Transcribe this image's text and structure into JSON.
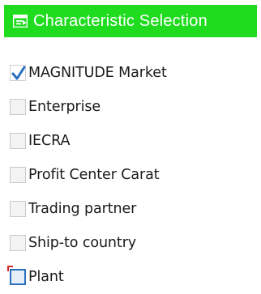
{
  "header": {
    "title": "Characteristic Selection",
    "icon": "selection-list-icon",
    "background": "#1fdc1f",
    "text_color": "#ffffff"
  },
  "characteristics": [
    {
      "label": "MAGNITUDE Market",
      "checked": true
    },
    {
      "label": "Enterprise",
      "checked": false
    },
    {
      "label": "IECRA",
      "checked": false
    },
    {
      "label": "Profit Center Carat",
      "checked": false
    },
    {
      "label": "Trading partner",
      "checked": false
    },
    {
      "label": "Ship-to country",
      "checked": false
    },
    {
      "label": "Plant",
      "checked": false,
      "focused": true
    }
  ],
  "colors": {
    "checkmark": "#2a6fbd",
    "focus_frame": "#2a6fbd",
    "focus_corner": "#d12b2b"
  }
}
